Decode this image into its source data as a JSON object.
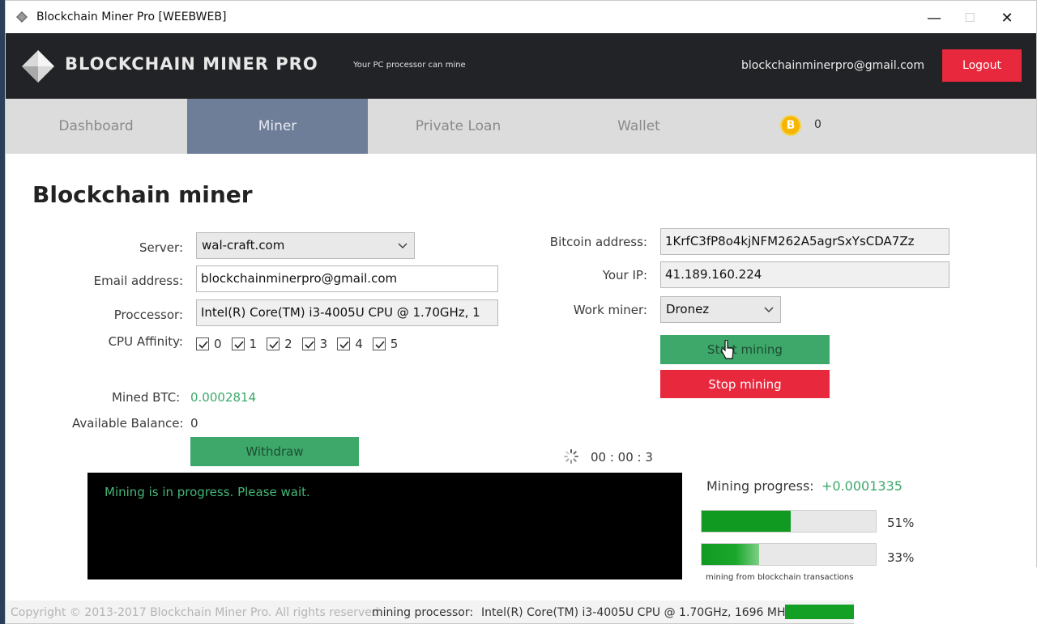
{
  "window": {
    "title": "Blockchain Miner Pro [WEEBWEB]",
    "minimize": "—",
    "maximize": "☐",
    "close": "✕"
  },
  "header": {
    "brand": "BLOCKCHAIN MINER PRO",
    "tagline": "Your PC processor can mine",
    "email": "blockchainminerpro@gmail.com",
    "logout_label": "Logout"
  },
  "tabs": [
    {
      "label": "Dashboard",
      "active": false
    },
    {
      "label": "Miner",
      "active": true
    },
    {
      "label": "Private Loan",
      "active": false
    },
    {
      "label": "Wallet",
      "active": false
    }
  ],
  "balance": {
    "icon": "bitcoin-coin-icon",
    "symbol": "B",
    "count": "0"
  },
  "page": {
    "title": "Blockchain miner"
  },
  "form_left": {
    "server_label": "Server:",
    "server_value": "wal-craft.com",
    "email_label": "Email address:",
    "email_value": "blockchainminerpro@gmail.com",
    "processor_label": "Proccessor:",
    "processor_value": "Intel(R) Core(TM) i3-4005U CPU @ 1.70GHz, 1",
    "cpu_affinity_label": "CPU Affinity:",
    "cpu_affinity": [
      "0",
      "1",
      "2",
      "3",
      "4",
      "5"
    ]
  },
  "form_right": {
    "bitcoin_label": "Bitcoin address:",
    "bitcoin_value": "1KrfC3fP8o4kjNFM262A5agrSxYsCDA7Zz",
    "ip_label": "Your IP:",
    "ip_value": "41.189.160.224",
    "work_miner_label": "Work miner:",
    "work_miner_value": "Dronez",
    "start_label": "Start mining",
    "stop_label": "Stop mining"
  },
  "stats": {
    "mined_label": "Mined BTC:",
    "mined_value": "0.0002814",
    "available_label": "Available Balance:",
    "available_value": "0",
    "withdraw_label": "Withdraw",
    "timer": "00 : 00 : 3"
  },
  "console": {
    "message": "Mining is in progress. Please wait."
  },
  "progress": {
    "label": "Mining progress:",
    "value": "+0.0001335",
    "bar1_pct_text": "51%",
    "bar1_fraction": 0.51,
    "bar2_pct_text": "33%",
    "bar2_fraction": 0.33,
    "caption": "mining from blockchain transactions s"
  },
  "footer": {
    "copyright": "Copyright © 2013-2017 Blockchain Miner Pro. All rights reserved",
    "processor_label": "mining processor:",
    "processor_value": "Intel(R) Core(TM) i3-4005U CPU @ 1.70GHz, 1696 MHz"
  },
  "colors": {
    "accent_green": "#3da86a",
    "stop_red": "#e8283c",
    "active_tab": "#6e7d98",
    "header_bg": "#222326"
  }
}
